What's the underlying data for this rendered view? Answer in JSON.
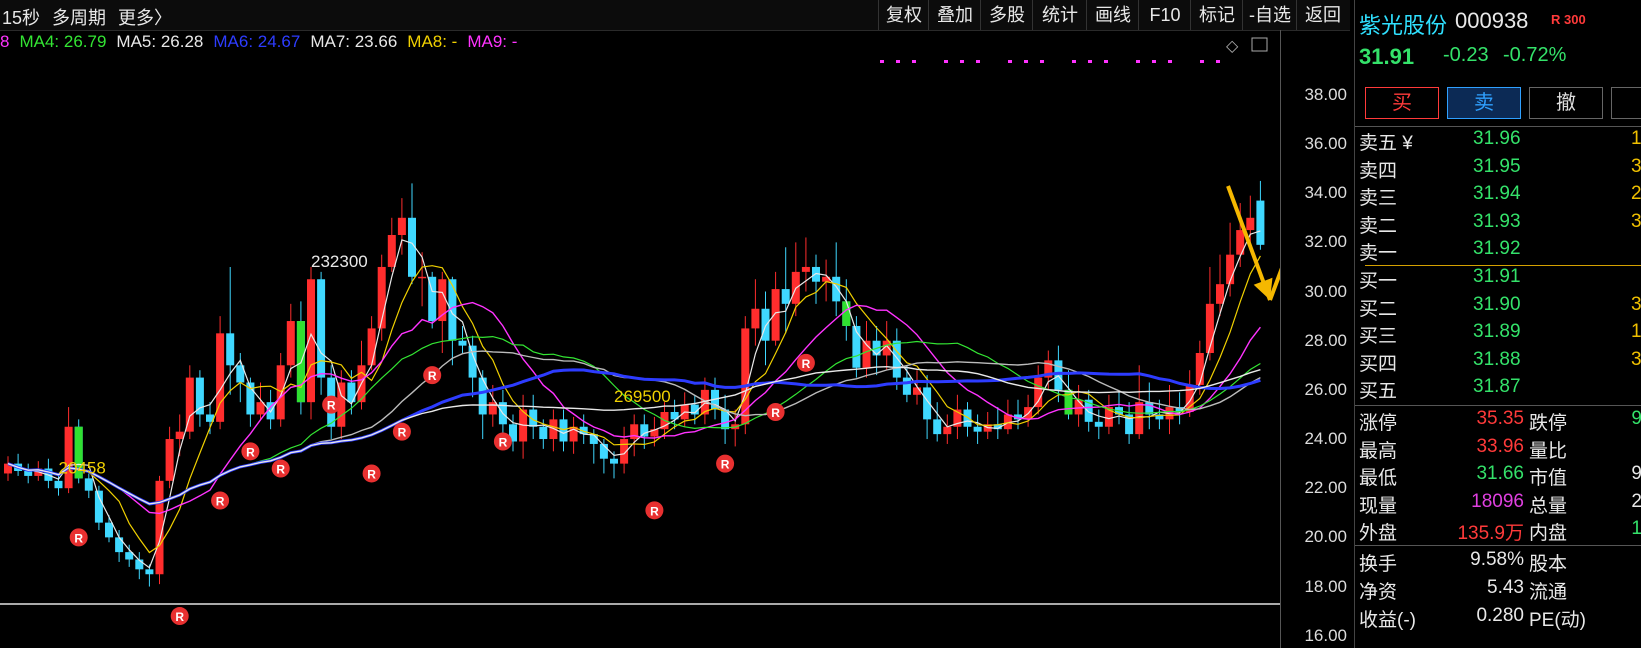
{
  "toolbar": {
    "period": "15秒",
    "multi_period": "多周期",
    "more": "更多〉",
    "buttons": [
      "复权",
      "叠加",
      "多股",
      "统计",
      "画线",
      "F10",
      "标记",
      "-自选",
      "返回"
    ]
  },
  "ma_legend": [
    {
      "label": "8",
      "color": "#ff33ff"
    },
    {
      "label": "MA4: 26.79",
      "color": "#33e533"
    },
    {
      "label": "MA5: 26.28",
      "color": "#e8e8e8"
    },
    {
      "label": "MA6: 24.67",
      "color": "#2d3cff"
    },
    {
      "label": "MA7: 23.66",
      "color": "#e8e8e8"
    },
    {
      "label": "MA8: -",
      "color": "#f0d000"
    },
    {
      "label": "MA9: -",
      "color": "#ff33ff"
    }
  ],
  "chart_data": {
    "type": "candlestick",
    "ylim": [
      15.5,
      39.5
    ],
    "yticks": [
      "38.00",
      "36.00",
      "34.00",
      "32.00",
      "30.00",
      "28.00",
      "26.00",
      "24.00",
      "22.00",
      "20.00",
      "18.00",
      "16.00"
    ],
    "annotations": [
      {
        "text": "232300",
        "index": 30,
        "price": 31.0,
        "color": "#e8e8e8"
      },
      {
        "text": "269500",
        "index": 60,
        "price": 25.5,
        "color": "#f0d000"
      },
      {
        "text": "20458",
        "index": 5,
        "price": 22.6,
        "color": "#f0d000"
      }
    ],
    "candles": [
      [
        22.6,
        23.0,
        23.3,
        22.3
      ],
      [
        23.0,
        22.7,
        23.4,
        22.5
      ],
      [
        22.7,
        22.5,
        23.0,
        22.2
      ],
      [
        22.5,
        22.8,
        23.1,
        22.3
      ],
      [
        22.8,
        22.3,
        23.2,
        22.0
      ],
      [
        22.3,
        22.0,
        22.6,
        21.7
      ],
      [
        22.0,
        24.5,
        25.3,
        21.8
      ],
      [
        24.5,
        22.4,
        24.8,
        22.2
      ],
      [
        22.4,
        21.9,
        22.6,
        21.6
      ],
      [
        21.9,
        20.6,
        22.1,
        20.3
      ],
      [
        20.6,
        20.0,
        20.9,
        19.8
      ],
      [
        20.0,
        19.4,
        20.3,
        19.0
      ],
      [
        19.4,
        19.1,
        19.7,
        18.8
      ],
      [
        19.1,
        18.7,
        19.4,
        18.3
      ],
      [
        18.7,
        18.5,
        18.9,
        18.0
      ],
      [
        18.5,
        22.3,
        22.5,
        18.1
      ],
      [
        22.3,
        24.0,
        24.5,
        22.0
      ],
      [
        24.0,
        24.3,
        25.0,
        23.3
      ],
      [
        24.3,
        26.5,
        27.0,
        24.0
      ],
      [
        26.5,
        25.0,
        26.8,
        24.5
      ],
      [
        25.0,
        24.7,
        25.5,
        24.2
      ],
      [
        24.7,
        28.3,
        29.0,
        24.4
      ],
      [
        28.3,
        27.0,
        31.0,
        25.8
      ],
      [
        27.0,
        26.3,
        27.5,
        25.5
      ],
      [
        26.3,
        25.0,
        26.5,
        24.5
      ],
      [
        25.0,
        25.5,
        26.3,
        24.8
      ],
      [
        25.5,
        24.8,
        26.0,
        24.4
      ],
      [
        24.8,
        27.0,
        27.5,
        24.5
      ],
      [
        27.0,
        28.8,
        29.5,
        26.5
      ],
      [
        28.8,
        25.5,
        29.6,
        25.0
      ],
      [
        25.5,
        30.5,
        31.0,
        24.8
      ],
      [
        30.5,
        26.5,
        30.8,
        25.8
      ],
      [
        26.5,
        24.5,
        27.0,
        24.0
      ],
      [
        24.5,
        26.3,
        26.8,
        24.0
      ],
      [
        26.3,
        25.5,
        26.8,
        25.0
      ],
      [
        25.5,
        27.0,
        28.0,
        25.2
      ],
      [
        27.0,
        28.5,
        29.0,
        26.8
      ],
      [
        28.5,
        31.0,
        31.5,
        28.0
      ],
      [
        31.0,
        32.3,
        33.0,
        30.8
      ],
      [
        32.3,
        33.0,
        33.8,
        31.5
      ],
      [
        33.0,
        30.6,
        34.4,
        30.3
      ],
      [
        30.6,
        30.6,
        31.6,
        29.4
      ],
      [
        30.6,
        28.8,
        30.8,
        28.5
      ],
      [
        28.8,
        30.5,
        30.8,
        27.5
      ],
      [
        30.5,
        28.0,
        30.6,
        27.0
      ],
      [
        28.0,
        27.8,
        28.6,
        27.5
      ],
      [
        27.8,
        26.5,
        28.2,
        25.7
      ],
      [
        26.5,
        25.0,
        26.8,
        24.0
      ],
      [
        25.0,
        25.5,
        26.2,
        24.5
      ],
      [
        25.5,
        24.6,
        26.0,
        24.2
      ],
      [
        24.6,
        23.9,
        25.0,
        23.5
      ],
      [
        23.9,
        25.2,
        25.8,
        23.2
      ],
      [
        25.2,
        24.5,
        25.8,
        24.0
      ],
      [
        24.5,
        24.0,
        24.8,
        23.6
      ],
      [
        24.0,
        24.8,
        25.2,
        23.5
      ],
      [
        24.8,
        23.9,
        25.2,
        23.5
      ],
      [
        23.9,
        24.5,
        24.9,
        23.4
      ],
      [
        24.5,
        24.2,
        25.0,
        23.8
      ],
      [
        24.2,
        23.8,
        24.4,
        23.0
      ],
      [
        23.8,
        23.2,
        24.0,
        22.6
      ],
      [
        23.2,
        23.0,
        23.5,
        22.4
      ],
      [
        23.0,
        24.0,
        24.5,
        22.6
      ],
      [
        24.0,
        24.6,
        25.0,
        23.3
      ],
      [
        24.6,
        24.1,
        25.0,
        23.6
      ],
      [
        24.1,
        24.4,
        24.9,
        23.7
      ],
      [
        24.4,
        25.1,
        25.5,
        24.0
      ],
      [
        25.1,
        24.8,
        25.6,
        24.4
      ],
      [
        24.8,
        25.4,
        25.9,
        24.5
      ],
      [
        25.4,
        25.0,
        25.8,
        24.6
      ],
      [
        25.0,
        26.0,
        26.5,
        24.6
      ],
      [
        26.0,
        25.2,
        26.5,
        24.8
      ],
      [
        25.2,
        24.4,
        25.8,
        23.8
      ],
      [
        24.4,
        24.6,
        25.2,
        23.7
      ],
      [
        24.6,
        28.5,
        29.0,
        24.2
      ],
      [
        28.5,
        29.3,
        30.5,
        27.8
      ],
      [
        29.3,
        28.0,
        30.0,
        27.0
      ],
      [
        28.0,
        30.1,
        30.8,
        27.8
      ],
      [
        30.1,
        29.5,
        31.8,
        28.3
      ],
      [
        29.5,
        30.8,
        32.0,
        29.0
      ],
      [
        30.8,
        31.0,
        32.2,
        30.0
      ],
      [
        31.0,
        30.4,
        31.5,
        29.5
      ],
      [
        30.4,
        30.6,
        31.3,
        29.6
      ],
      [
        30.6,
        29.6,
        32.0,
        29.0
      ],
      [
        29.6,
        28.6,
        30.5,
        28.0
      ],
      [
        28.6,
        26.9,
        29.0,
        26.5
      ],
      [
        26.9,
        28.0,
        28.8,
        26.5
      ],
      [
        28.0,
        27.4,
        28.6,
        26.6
      ],
      [
        27.4,
        28.0,
        28.8,
        26.8
      ],
      [
        28.0,
        26.5,
        28.5,
        26.0
      ],
      [
        26.5,
        25.8,
        27.0,
        25.5
      ],
      [
        25.8,
        26.1,
        26.8,
        25.4
      ],
      [
        26.1,
        24.8,
        26.6,
        24.0
      ],
      [
        24.8,
        24.2,
        25.5,
        23.9
      ],
      [
        24.2,
        24.5,
        25.0,
        23.8
      ],
      [
        24.5,
        25.2,
        25.8,
        24.0
      ],
      [
        25.2,
        24.5,
        25.5,
        24.1
      ],
      [
        24.5,
        24.3,
        25.0,
        23.8
      ],
      [
        24.3,
        24.6,
        25.1,
        24.0
      ],
      [
        24.6,
        24.4,
        25.3,
        24.0
      ],
      [
        24.4,
        25.0,
        25.6,
        24.2
      ],
      [
        25.0,
        24.8,
        25.6,
        24.4
      ],
      [
        24.8,
        25.3,
        25.8,
        24.5
      ],
      [
        25.3,
        26.5,
        27.0,
        25.0
      ],
      [
        26.5,
        27.2,
        27.6,
        26.0
      ],
      [
        27.2,
        26.0,
        27.8,
        25.5
      ],
      [
        26.0,
        25.0,
        26.8,
        24.8
      ],
      [
        25.0,
        25.6,
        26.2,
        24.5
      ],
      [
        25.6,
        24.7,
        26.0,
        24.3
      ],
      [
        24.7,
        24.5,
        25.2,
        24.0
      ],
      [
        24.5,
        25.3,
        25.8,
        24.2
      ],
      [
        25.3,
        25.0,
        25.9,
        24.6
      ],
      [
        25.0,
        24.2,
        25.5,
        23.8
      ],
      [
        24.2,
        25.5,
        27.0,
        24.0
      ],
      [
        25.5,
        25.0,
        26.3,
        24.4
      ],
      [
        25.0,
        24.8,
        25.6,
        24.4
      ],
      [
        24.8,
        25.3,
        26.2,
        24.2
      ],
      [
        25.3,
        25.1,
        25.9,
        24.6
      ],
      [
        25.1,
        26.2,
        26.8,
        24.9
      ],
      [
        26.2,
        27.5,
        28.0,
        25.8
      ],
      [
        27.5,
        29.5,
        31.0,
        27.2
      ],
      [
        29.5,
        30.3,
        31.5,
        29.0
      ],
      [
        30.3,
        31.5,
        32.8,
        29.8
      ],
      [
        31.5,
        32.5,
        33.6,
        31.0
      ],
      [
        32.5,
        33.0,
        33.9,
        32.0
      ],
      [
        33.7,
        31.9,
        34.5,
        31.7
      ]
    ],
    "series": [
      {
        "name": "MA4",
        "color": "#33e533"
      },
      {
        "name": "MA5",
        "color": "#e8e8e8"
      },
      {
        "name": "MA6",
        "color": "#2d3cff"
      },
      {
        "name": "MA7",
        "color": "#e8e8e8"
      },
      {
        "name": "MA8",
        "color": "#f0d000"
      },
      {
        "name": "MA9",
        "color": "#ff33ff"
      }
    ],
    "r_markers": [
      [
        7,
        20.0
      ],
      [
        17,
        16.8
      ],
      [
        21,
        21.5
      ],
      [
        24,
        23.5
      ],
      [
        27,
        22.8
      ],
      [
        32,
        25.4
      ],
      [
        36,
        22.6
      ],
      [
        39,
        24.3
      ],
      [
        42,
        26.6
      ],
      [
        49,
        23.9
      ],
      [
        64,
        21.1
      ],
      [
        71,
        23.0
      ],
      [
        76,
        25.1
      ],
      [
        79,
        27.1
      ]
    ]
  },
  "panel": {
    "stock_name": "紫光股份",
    "stock_code": "000938",
    "r_badge": "R",
    "r_number": "300",
    "price": "31.91",
    "change": "-0.23",
    "change_pct": "-0.72%",
    "buy_label": "买",
    "sell_label": "卖",
    "cancel_label": "撤",
    "order_book": [
      {
        "label": "卖五",
        "currency": "¥",
        "price": "31.96",
        "vol": "1"
      },
      {
        "label": "卖四",
        "currency": "",
        "price": "31.95",
        "vol": "3"
      },
      {
        "label": "卖三",
        "currency": "",
        "price": "31.94",
        "vol": "2"
      },
      {
        "label": "卖二",
        "currency": "",
        "price": "31.93",
        "vol": "3"
      },
      {
        "label": "卖一",
        "currency": "",
        "price": "31.92",
        "vol": ""
      },
      {
        "label": "买一",
        "currency": "",
        "price": "31.91",
        "vol": ""
      },
      {
        "label": "买二",
        "currency": "",
        "price": "31.90",
        "vol": "3"
      },
      {
        "label": "买三",
        "currency": "",
        "price": "31.89",
        "vol": "1"
      },
      {
        "label": "买四",
        "currency": "",
        "price": "31.88",
        "vol": "3"
      },
      {
        "label": "买五",
        "currency": "",
        "price": "31.87",
        "vol": ""
      }
    ],
    "stats_left": [
      {
        "k": "涨停",
        "v": "35.35",
        "color": "#ff3a3a"
      },
      {
        "k": "最高",
        "v": "33.96",
        "color": "#ff3a3a"
      },
      {
        "k": "最低",
        "v": "31.66",
        "color": "#34e26a"
      },
      {
        "k": "现量",
        "v": "18096",
        "color": "#e040e0"
      },
      {
        "k": "外盘",
        "v": "135.9万",
        "color": "#ff3a3a"
      }
    ],
    "stats_right": [
      {
        "k": "跌停",
        "v": "9",
        "color": "#34e26a"
      },
      {
        "k": "量比",
        "v": "",
        "color": "#e8e8e8"
      },
      {
        "k": "市值",
        "v": "9",
        "color": "#e8e8e8"
      },
      {
        "k": "总量",
        "v": "2",
        "color": "#e8e8e8"
      },
      {
        "k": "内盘",
        "v": "1",
        "color": "#34e26a"
      }
    ],
    "stats2_left": [
      {
        "k": "换手",
        "v": "9.58%",
        "color": "#e8e8e8"
      },
      {
        "k": "净资",
        "v": "5.43",
        "color": "#e8e8e8"
      },
      {
        "k": "收益(-)",
        "v": "0.280",
        "color": "#e8e8e8"
      }
    ],
    "stats2_right": [
      {
        "k": "股本",
        "v": ""
      },
      {
        "k": "流通",
        "v": ""
      },
      {
        "k": "PE(动)",
        "v": ""
      }
    ]
  }
}
